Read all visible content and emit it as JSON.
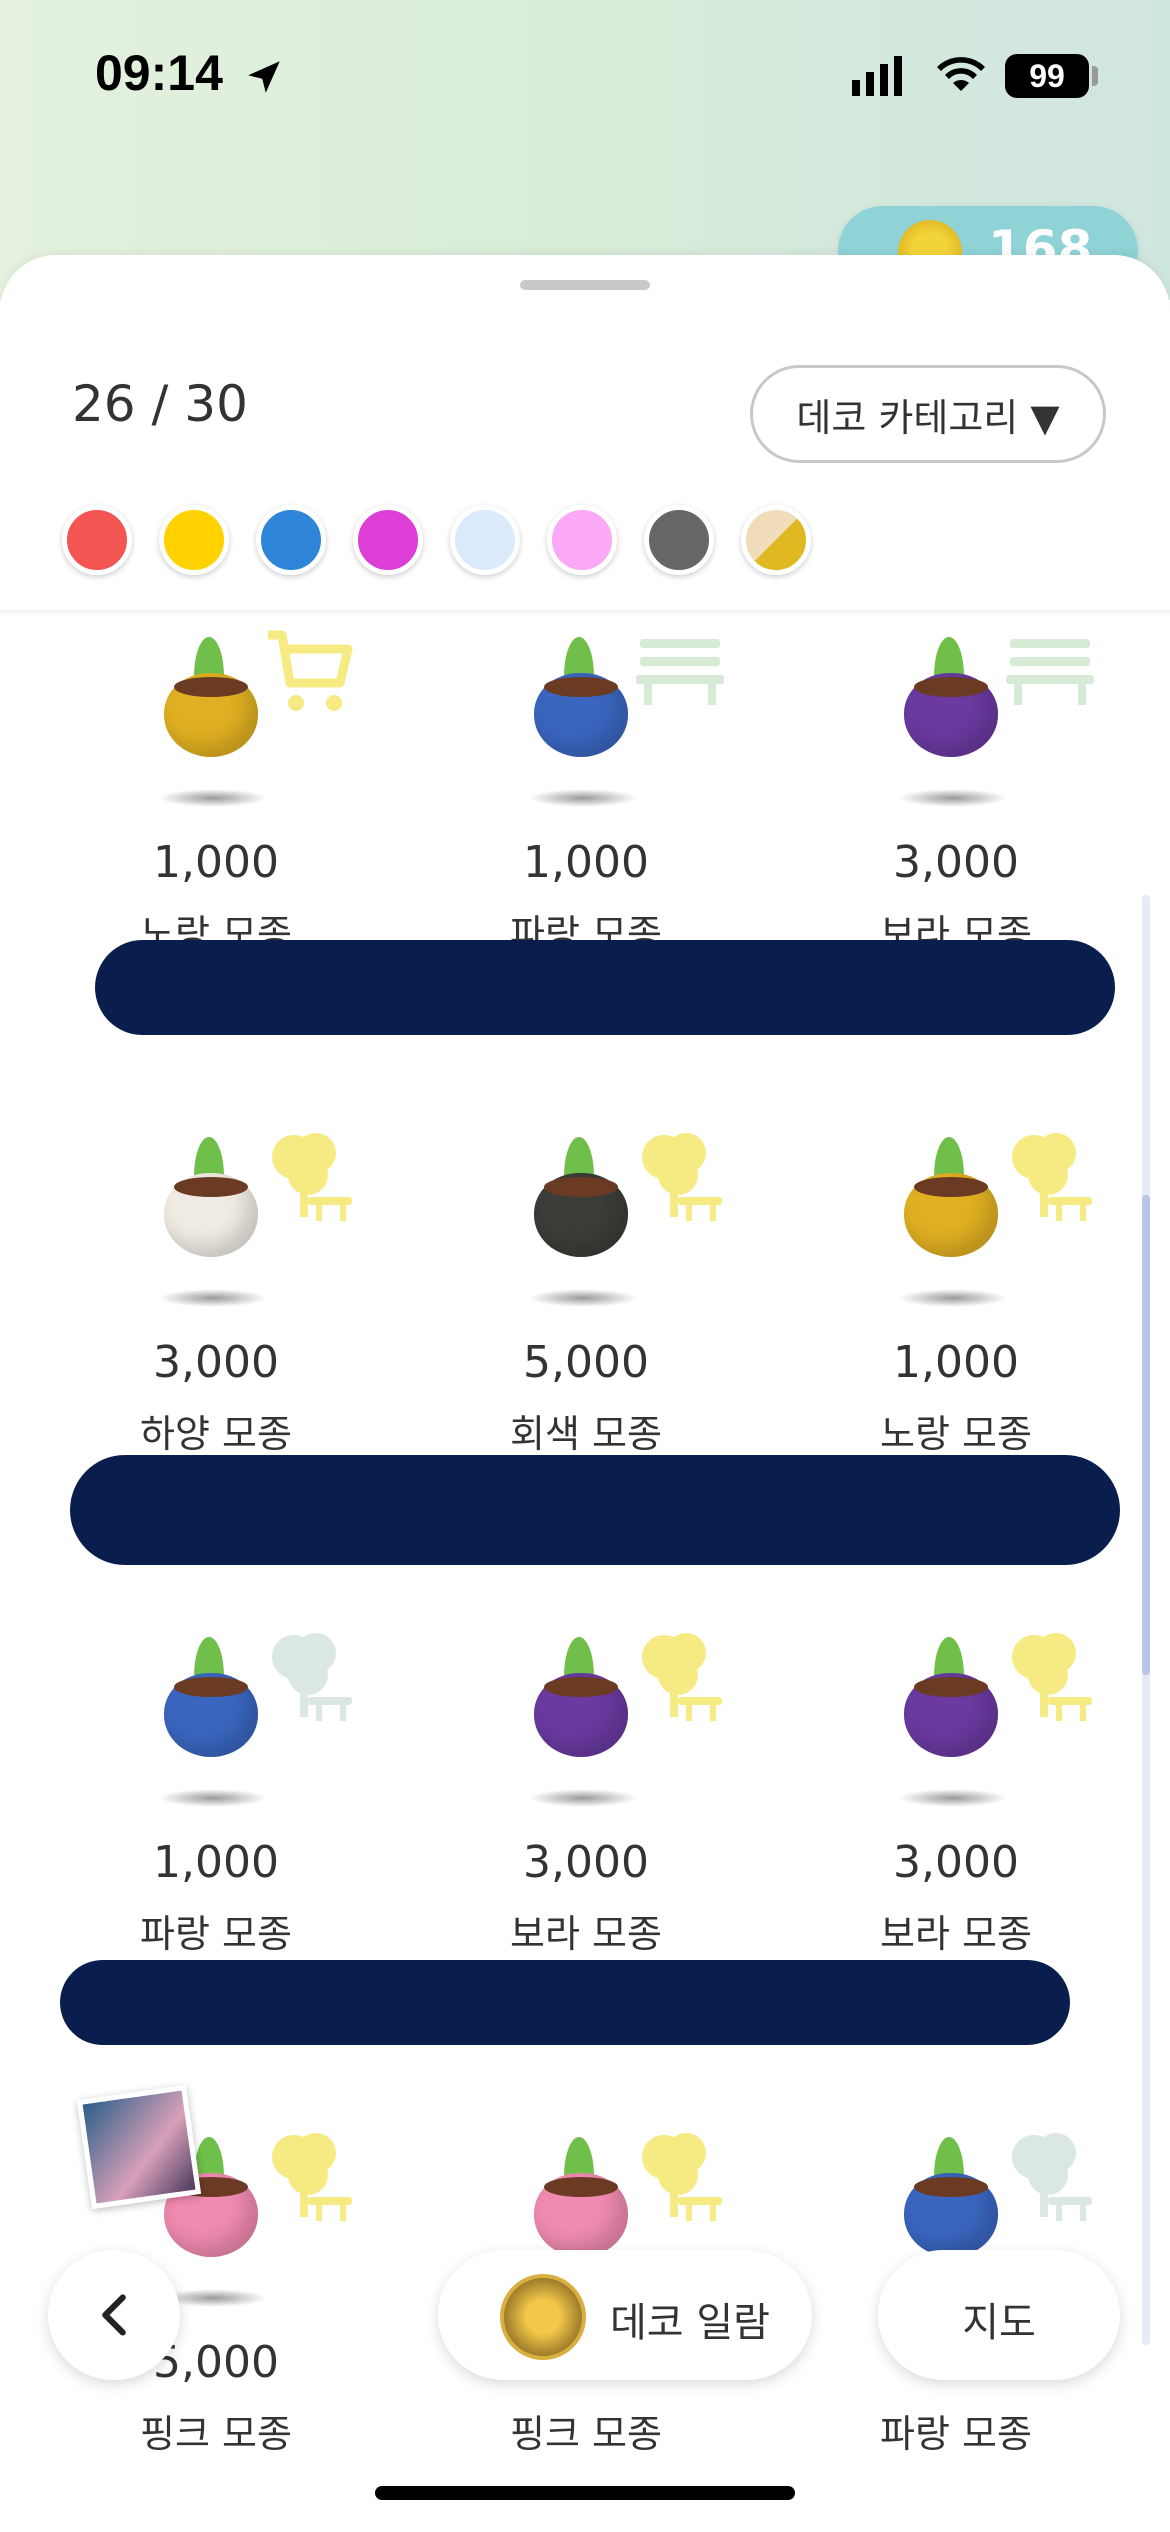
{
  "status_bar": {
    "time": "09:14",
    "battery": "99"
  },
  "coin_balance": "168",
  "deco": {
    "counter": "26 / 30",
    "category_button": "데코 카테고리 ▼",
    "swatches": [
      "#f25552",
      "#ffd200",
      "#2f86d8",
      "#dd3fd6",
      "#dcebfb",
      "#fba8f6",
      "#666666",
      "#e0b822"
    ]
  },
  "items": [
    {
      "price": "1,000",
      "name": "노랑 모종",
      "pot_color": "#e0b022",
      "badge": "cart-icon"
    },
    {
      "price": "1,000",
      "name": "파랑 모종",
      "pot_color": "#3a66c0",
      "badge": "bench-icon"
    },
    {
      "price": "3,000",
      "name": "보라 모종",
      "pot_color": "#6a3aa0",
      "badge": "bench-icon"
    },
    {
      "price": "3,000",
      "name": "하양 모종",
      "pot_color": "#f0ece4",
      "badge": "tree-bench-icon"
    },
    {
      "price": "5,000",
      "name": "회색 모종",
      "pot_color": "#3c3c38",
      "badge": "tree-bench-icon"
    },
    {
      "price": "1,000",
      "name": "노랑 모종",
      "pot_color": "#e0b022",
      "badge": "tree-bench-icon"
    },
    {
      "price": "1,000",
      "name": "파랑 모종",
      "pot_color": "#3a66c0",
      "badge": "tree-bench-icon"
    },
    {
      "price": "3,000",
      "name": "보라 모종",
      "pot_color": "#6a3aa0",
      "badge": "tree-bench-icon"
    },
    {
      "price": "3,000",
      "name": "보라 모종",
      "pot_color": "#6a3aa0",
      "badge": "tree-bench-icon"
    },
    {
      "price": "5,000",
      "name": "핑크 모종",
      "pot_color": "#f08ab0",
      "badge": "tree-bench-icon"
    },
    {
      "price": "",
      "name": "핑크 모종",
      "pot_color": "#f08ab0",
      "badge": "tree-bench-icon"
    },
    {
      "price": "",
      "name": "파랑 모종",
      "pot_color": "#3a66c0",
      "badge": "tree-bench-icon"
    }
  ],
  "bottom_nav": {
    "deco_view": "데코 일람",
    "map": "지도"
  }
}
